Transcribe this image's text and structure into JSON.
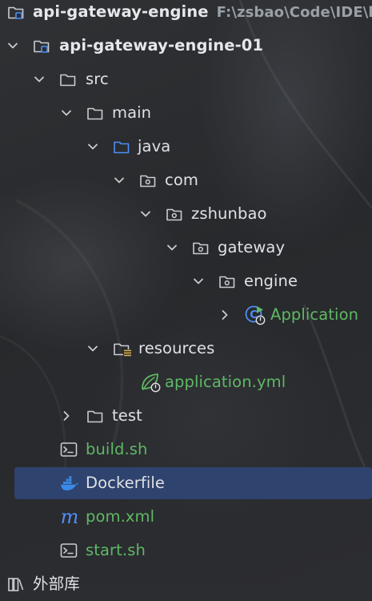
{
  "project": {
    "root": {
      "name": "api-gateway-engine",
      "path": "F:\\zsbao\\Code\\IDE\\bu"
    },
    "items": [
      {
        "name": "api-gateway-engine-01"
      },
      {
        "name": "src"
      },
      {
        "name": "main"
      },
      {
        "name": "java"
      },
      {
        "name": "com"
      },
      {
        "name": "zshunbao"
      },
      {
        "name": "gateway"
      },
      {
        "name": "engine"
      },
      {
        "name": "Application"
      },
      {
        "name": "resources"
      },
      {
        "name": "application.yml"
      },
      {
        "name": "test"
      },
      {
        "name": "build.sh"
      },
      {
        "name": "Dockerfile"
      },
      {
        "name": "pom.xml"
      },
      {
        "name": "start.sh"
      },
      {
        "name": "外部库"
      }
    ]
  },
  "colors": {
    "background": "#2b2d30",
    "selection": "#2e436e",
    "text": "#dfe1e5",
    "green_text": "#5fb865",
    "folder_icon": "#c9ccd1",
    "source_folder_icon": "#4f8ef7",
    "docker_icon": "#3b8ae6",
    "maven_icon": "#4f8ef7"
  },
  "icons": {
    "module": "module-folder-icon",
    "folder": "folder-icon",
    "source_folder": "source-folder-icon",
    "package": "package-icon",
    "class": "spring-boot-class-icon",
    "resources": "resources-folder-icon",
    "yaml": "spring-yaml-icon",
    "shell": "shell-script-icon",
    "docker": "docker-icon",
    "maven": "maven-icon",
    "library": "external-libraries-icon"
  }
}
